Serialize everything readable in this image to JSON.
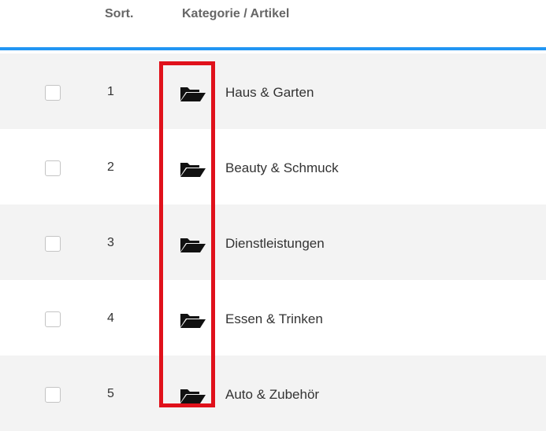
{
  "header": {
    "sort_label": "Sort.",
    "category_label": "Kategorie / Artikel"
  },
  "rows": [
    {
      "sort": "1",
      "label": "Haus & Garten",
      "icon": "folder-open-icon"
    },
    {
      "sort": "2",
      "label": "Beauty & Schmuck",
      "icon": "folder-open-icon"
    },
    {
      "sort": "3",
      "label": "Dienstleistungen",
      "icon": "folder-open-icon"
    },
    {
      "sort": "4",
      "label": "Essen & Trinken",
      "icon": "folder-open-icon"
    },
    {
      "sort": "5",
      "label": "Auto & Zubehör",
      "icon": "folder-open-icon"
    }
  ],
  "colors": {
    "accent": "#2196f3",
    "highlight": "#e0111b",
    "row_stripe": "#f3f3f3"
  }
}
